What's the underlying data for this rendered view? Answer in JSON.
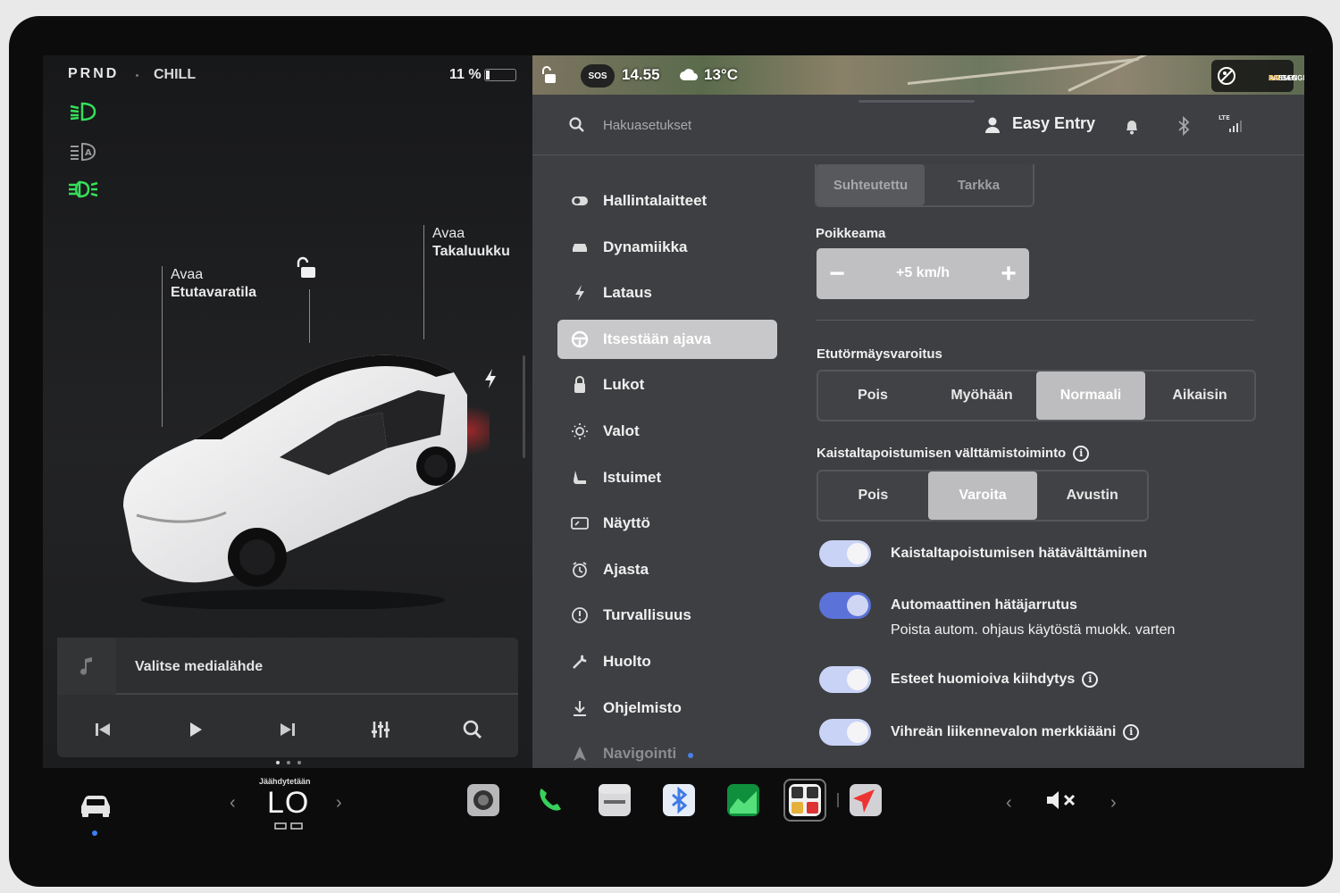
{
  "status": {
    "gear": "PRND",
    "drive_mode": "CHILL",
    "battery_pct": "11 %",
    "battery_level": 0.11,
    "sos": "SOS",
    "time": "14.55",
    "temp": "13°C",
    "airbag_line1": "PASSENGER",
    "airbag_line2": "AIRBAG",
    "airbag_state": "ON"
  },
  "car": {
    "frunk_top": "Avaa",
    "frunk_bottom": "Etutavaratila",
    "trunk_top": "Avaa",
    "trunk_bottom": "Takaluukku"
  },
  "media": {
    "source_label": "Valitse medialähde"
  },
  "search": {
    "placeholder": "Hakuasetukset"
  },
  "profile": {
    "name": "Easy Entry"
  },
  "nav": [
    {
      "label": "Hallintalaitteet",
      "icon": "toggle-icon"
    },
    {
      "label": "Dynamiikka",
      "icon": "car-icon"
    },
    {
      "label": "Lataus",
      "icon": "bolt-icon"
    },
    {
      "label": "Itsestään ajava",
      "icon": "steering-wheel-icon",
      "active": true
    },
    {
      "label": "Lukot",
      "icon": "lock-icon"
    },
    {
      "label": "Valot",
      "icon": "sun-icon"
    },
    {
      "label": "Istuimet",
      "icon": "seat-icon"
    },
    {
      "label": "Näyttö",
      "icon": "display-icon"
    },
    {
      "label": "Ajasta",
      "icon": "clock-icon"
    },
    {
      "label": "Turvallisuus",
      "icon": "alert-icon"
    },
    {
      "label": "Huolto",
      "icon": "wrench-icon"
    },
    {
      "label": "Ohjelmisto",
      "icon": "download-icon"
    },
    {
      "label": "Navigointi",
      "icon": "navigation-icon"
    }
  ],
  "settings": {
    "display_mode": {
      "options": [
        "Suhteutettu",
        "Tarkka"
      ],
      "selected": 0
    },
    "offset_label": "Poikkeama",
    "offset_value": "+5 km/h",
    "fcw_label": "Etutörmäysvaroitus",
    "fcw": {
      "options": [
        "Pois",
        "Myöhään",
        "Normaali",
        "Aikaisin"
      ],
      "selected": 2
    },
    "lane_label": "Kaistaltapoistumisen välttämistoiminto",
    "lane": {
      "options": [
        "Pois",
        "Varoita",
        "Avustin"
      ],
      "selected": 1
    },
    "toggles": [
      {
        "label": "Kaistaltapoistumisen hätävälttäminen",
        "on": true
      },
      {
        "label": "Automaattinen hätäjarrutus",
        "sub": "Poista autom. ohjaus käytöstä muokk. varten",
        "on": true
      },
      {
        "label": "Esteet huomioiva kiihdytys",
        "on": true,
        "info": true
      },
      {
        "label": "Vihreän liikennevalon merkkiääni",
        "on": true,
        "info": true
      }
    ]
  },
  "climate": {
    "caption": "Jäähdytetään",
    "temp": "LO"
  },
  "colors": {
    "accent": "#5b72d8",
    "toggle_on_light": "#c9d3f6",
    "green_lamp": "#35e05a"
  }
}
